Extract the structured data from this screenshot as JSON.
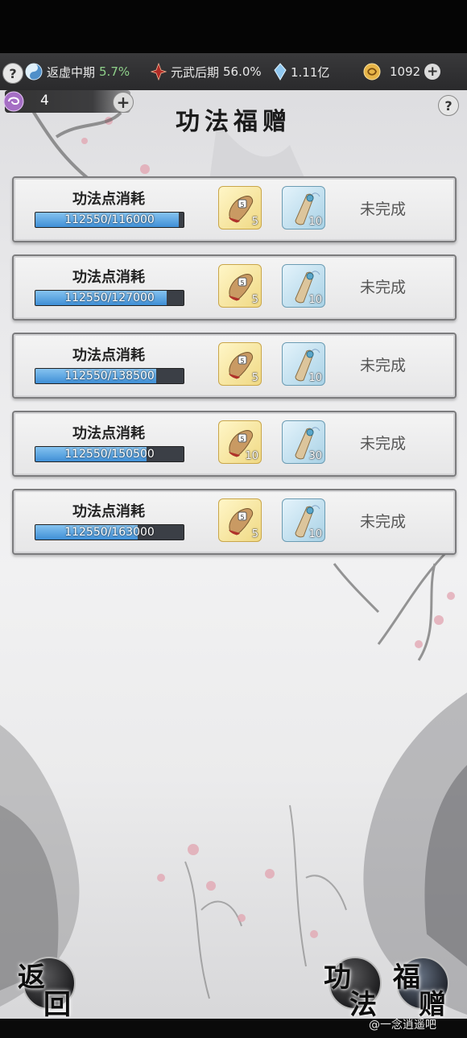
{
  "status": {
    "help_icon": "question-icon",
    "realm_name": "返虚中期",
    "realm_progress": "5.7%",
    "body_realm": "元武后期",
    "body_progress": "56.0%",
    "spirit_stones": "1.11亿",
    "coins": "1092"
  },
  "ticket": {
    "count": "4"
  },
  "page_title": "功法福赠",
  "tasks": [
    {
      "label": "功法点消耗",
      "progress_text": "112550/116000",
      "progress_value": 0.97,
      "reward_a_count": "5",
      "reward_b_count": "10",
      "status": "未完成"
    },
    {
      "label": "功法点消耗",
      "progress_text": "112550/127000",
      "progress_value": 0.886,
      "reward_a_count": "5",
      "reward_b_count": "10",
      "status": "未完成"
    },
    {
      "label": "功法点消耗",
      "progress_text": "112550/138500",
      "progress_value": 0.813,
      "reward_a_count": "5",
      "reward_b_count": "10",
      "status": "未完成"
    },
    {
      "label": "功法点消耗",
      "progress_text": "112550/150500",
      "progress_value": 0.748,
      "reward_a_count": "10",
      "reward_b_count": "30",
      "status": "未完成"
    },
    {
      "label": "功法点消耗",
      "progress_text": "112550/163000",
      "progress_value": 0.69,
      "reward_a_count": "5",
      "reward_b_count": "10",
      "status": "未完成"
    }
  ],
  "nav": {
    "back": [
      "返",
      "回"
    ],
    "skills": [
      "功",
      "法"
    ],
    "gift": [
      "福",
      "赠"
    ]
  },
  "watermark": "@一念逍遥吧",
  "colors": {
    "progress_fill": "#4a98dc",
    "status_green": "#8fd18a"
  }
}
